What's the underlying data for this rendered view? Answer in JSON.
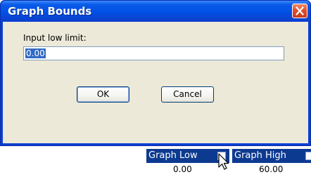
{
  "dialog": {
    "title": "Graph Bounds",
    "prompt": "Input low limit:",
    "input_value": "0.00",
    "ok_label": "OK",
    "cancel_label": "Cancel"
  },
  "table": {
    "headers": [
      {
        "label": "Graph Low",
        "value": "0.00"
      },
      {
        "label": "Graph High",
        "value": "60.00"
      }
    ]
  },
  "colors": {
    "titlebar": "#0050e6",
    "close_button": "#e0502e",
    "dialog_face": "#ece9d8",
    "selection": "#316ac5",
    "header_bg": "#0d3a91"
  },
  "icons": [
    "close-icon",
    "mouse-pointer-icon"
  ]
}
